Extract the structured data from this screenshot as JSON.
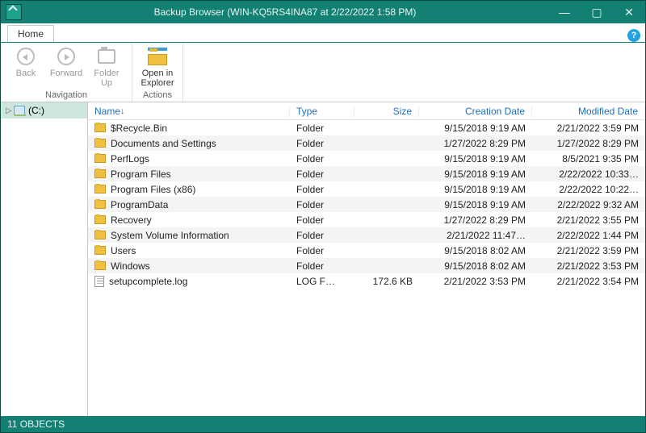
{
  "window": {
    "title": "Backup Browser (WIN-KQ5RS4INA87 at 2/22/2022 1:58 PM)"
  },
  "tabs": {
    "home": "Home"
  },
  "ribbon": {
    "back": "Back",
    "forward": "Forward",
    "folder_up": "Folder\nUp",
    "open_in_explorer": "Open in\nExplorer",
    "group_navigation": "Navigation",
    "group_actions": "Actions"
  },
  "tree": {
    "root": "(C:)"
  },
  "columns": {
    "name": "Name",
    "type": "Type",
    "size": "Size",
    "cdate": "Creation Date",
    "mdate": "Modified Date"
  },
  "rows": [
    {
      "icon": "folder",
      "name": "$Recycle.Bin",
      "type": "Folder",
      "size": "",
      "cdate": "9/15/2018 9:19 AM",
      "mdate": "2/21/2022 3:59 PM"
    },
    {
      "icon": "folder",
      "name": "Documents and Settings",
      "type": "Folder",
      "size": "",
      "cdate": "1/27/2022 8:29 PM",
      "mdate": "1/27/2022 8:29 PM"
    },
    {
      "icon": "folder",
      "name": "PerfLogs",
      "type": "Folder",
      "size": "",
      "cdate": "9/15/2018 9:19 AM",
      "mdate": "8/5/2021 9:35 PM"
    },
    {
      "icon": "folder",
      "name": "Program Files",
      "type": "Folder",
      "size": "",
      "cdate": "9/15/2018 9:19 AM",
      "mdate": "2/22/2022 10:33…"
    },
    {
      "icon": "folder",
      "name": "Program Files (x86)",
      "type": "Folder",
      "size": "",
      "cdate": "9/15/2018 9:19 AM",
      "mdate": "2/22/2022 10:22…"
    },
    {
      "icon": "folder",
      "name": "ProgramData",
      "type": "Folder",
      "size": "",
      "cdate": "9/15/2018 9:19 AM",
      "mdate": "2/22/2022 9:32 AM"
    },
    {
      "icon": "folder",
      "name": "Recovery",
      "type": "Folder",
      "size": "",
      "cdate": "1/27/2022 8:29 PM",
      "mdate": "2/21/2022 3:55 PM"
    },
    {
      "icon": "folder",
      "name": "System Volume Information",
      "type": "Folder",
      "size": "",
      "cdate": "2/21/2022 11:47…",
      "mdate": "2/22/2022 1:44 PM"
    },
    {
      "icon": "folder",
      "name": "Users",
      "type": "Folder",
      "size": "",
      "cdate": "9/15/2018 8:02 AM",
      "mdate": "2/21/2022 3:59 PM"
    },
    {
      "icon": "folder",
      "name": "Windows",
      "type": "Folder",
      "size": "",
      "cdate": "9/15/2018 8:02 AM",
      "mdate": "2/21/2022 3:53 PM"
    },
    {
      "icon": "file",
      "name": "setupcomplete.log",
      "type": "LOG F…",
      "size": "172.6 KB",
      "cdate": "2/21/2022 3:53 PM",
      "mdate": "2/21/2022 3:54 PM"
    }
  ],
  "status": "11 OBJECTS"
}
